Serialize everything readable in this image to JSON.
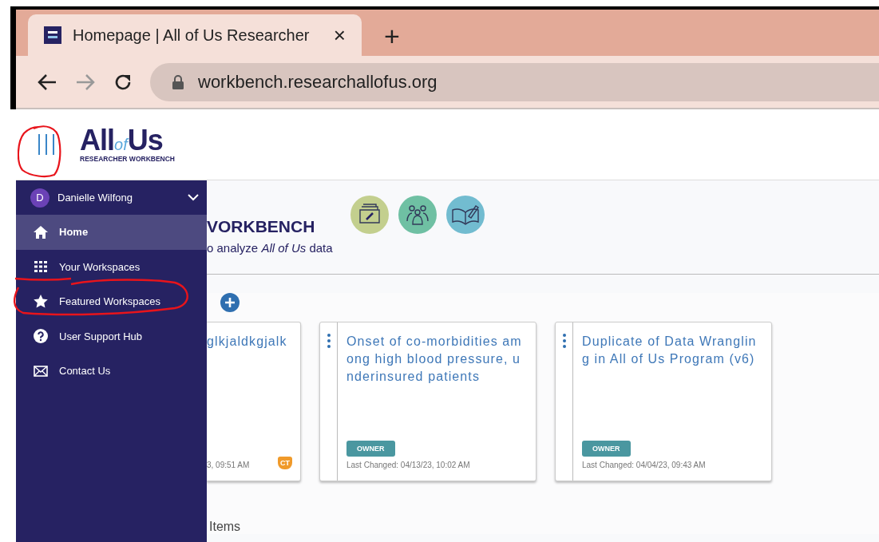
{
  "browser": {
    "tab_title": "Homepage | All of Us Researcher",
    "tab_close": "×",
    "new_tab": "+",
    "url": "workbench.researchallofus.org"
  },
  "header": {
    "logo_all": "All",
    "logo_of": "of",
    "logo_us": "Us",
    "logo_subtitle": "RESEARCHER WORKBENCH"
  },
  "sidebar": {
    "user": {
      "initial": "D",
      "name": "Danielle Wilfong"
    },
    "items": [
      {
        "kind": "home",
        "label": "Home",
        "selected": true
      },
      {
        "kind": "grid",
        "label": "Your Workspaces",
        "selected": false
      },
      {
        "kind": "star",
        "label": "Featured Workspaces",
        "selected": false
      },
      {
        "kind": "help",
        "label": "User Support Hub",
        "selected": false
      },
      {
        "kind": "mail",
        "label": "Contact Us",
        "selected": false
      }
    ]
  },
  "hero": {
    "title": "VORKBENCH",
    "subtitle": "o analyze *All of Us* data"
  },
  "workspaces": [
    {
      "clipped": true,
      "title": "glkjaldkgjalk",
      "last_changed": "3, 09:51 AM",
      "badge": "CT"
    },
    {
      "clipped": false,
      "title": "Onset of co-morbidities among high blood pressure, underinsured patients",
      "role": "OWNER",
      "last_changed": "Last Changed: 04/13/23, 10:02 AM"
    },
    {
      "clipped": false,
      "title": "Duplicate of Data Wrangling in All of Us Program (v6)",
      "role": "OWNER",
      "last_changed": "Last Changed: 04/04/23, 09:43 AM"
    }
  ],
  "section_label": "Items"
}
